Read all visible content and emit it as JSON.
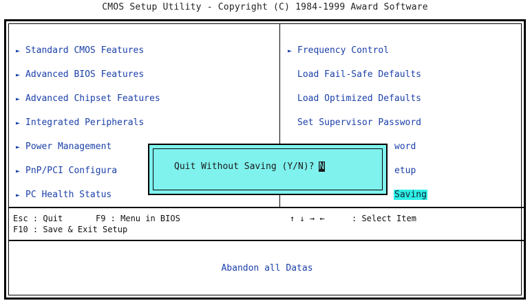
{
  "title": "CMOS Setup Utility - Copyright (C) 1984-1999 Award Software",
  "left_menu": [
    {
      "label": "Standard CMOS Features",
      "arrow": "►"
    },
    {
      "label": "Advanced BIOS Features",
      "arrow": "►"
    },
    {
      "label": "Advanced Chipset Features",
      "arrow": "►"
    },
    {
      "label": "Integrated Peripherals",
      "arrow": "►"
    },
    {
      "label": "Power Management",
      "arrow": "►"
    },
    {
      "label": "PnP/PCI Configura",
      "arrow": "►"
    },
    {
      "label": "PC Health Status",
      "arrow": "►"
    }
  ],
  "right_menu": [
    {
      "label": "Frequency Control",
      "arrow": "►"
    },
    {
      "label": "Load Fail-Safe Defaults"
    },
    {
      "label": "Load Optimized Defaults"
    },
    {
      "label": "Set Supervisor Password"
    },
    {
      "label": "word"
    },
    {
      "label": "etup"
    },
    {
      "label": "Saving"
    }
  ],
  "help": {
    "esc": "Esc : Quit",
    "f9": "F9 : Menu in BIOS",
    "arrows": "↑ ↓ → ←",
    "select": ": Select Item",
    "f10": "F10 : Save & Exit Setup"
  },
  "status_text": "Abandon all Datas",
  "dialog": {
    "prompt": "Quit Without Saving (Y/N)?",
    "value": "N"
  },
  "colors": {
    "menu_text": "#1a3fa8",
    "highlight": "#2ef0e6",
    "dialog_bg": "#7ff2ee"
  }
}
